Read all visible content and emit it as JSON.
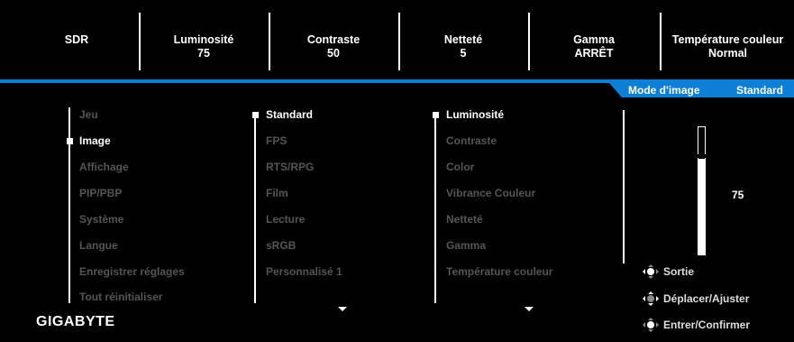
{
  "top_bar": [
    {
      "label": "SDR",
      "value": ""
    },
    {
      "label": "Luminosité",
      "value": "75"
    },
    {
      "label": "Contraste",
      "value": "50"
    },
    {
      "label": "Netteté",
      "value": "5"
    },
    {
      "label": "Gamma",
      "value": "ARRÊT"
    },
    {
      "label": "Température couleur",
      "value": "Normal"
    }
  ],
  "mode_tab": {
    "label": "Mode d'image",
    "value": "Standard"
  },
  "main_menu": [
    "Jeu",
    "Image",
    "Affichage",
    "PIP/PBP",
    "Système",
    "Langue",
    "Enregistrer réglages",
    "Tout réinitialiser"
  ],
  "main_menu_selected": "Image",
  "picture_modes": [
    "Standard",
    "FPS",
    "RTS/RPG",
    "Film",
    "Lecture",
    "sRGB",
    "Personnalisé 1"
  ],
  "picture_modes_selected": "Standard",
  "settings": [
    "Luminosité",
    "Contraste",
    "Color",
    "Vibrance Couleur",
    "Netteté",
    "Gamma",
    "Température couleur"
  ],
  "settings_selected": "Luminosité",
  "slider": {
    "value": "75",
    "level": 75
  },
  "hints": {
    "exit": "Sortie",
    "move": "Déplacer/Ajuster",
    "enter": "Entrer/Confirmer"
  },
  "logo": "GIGABYTE",
  "colors": {
    "accent": "#0d7fd6",
    "background": "#000000",
    "inactive_text": "#555555"
  }
}
